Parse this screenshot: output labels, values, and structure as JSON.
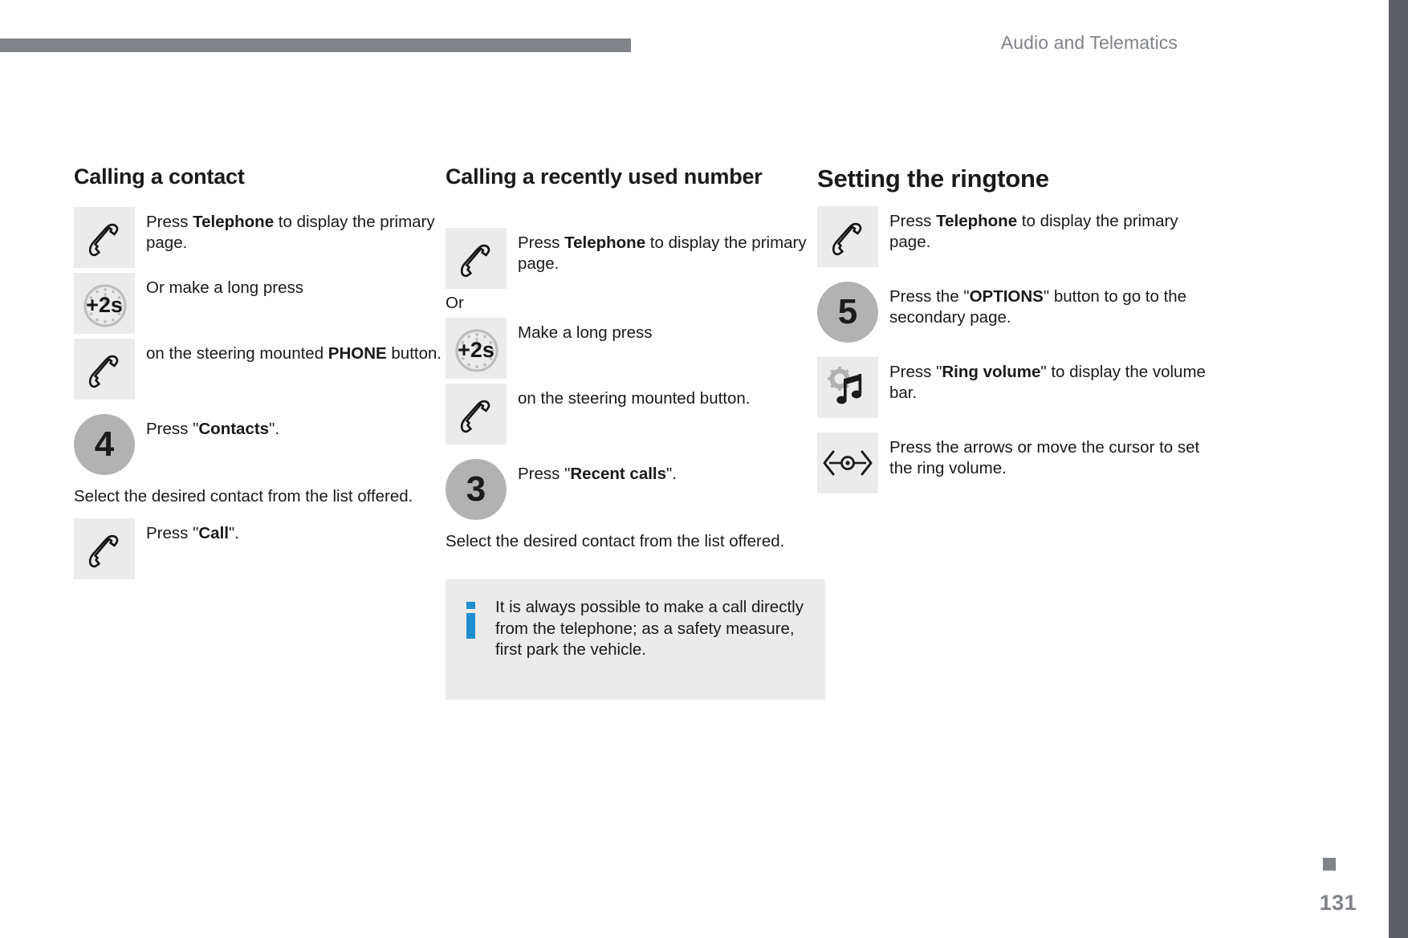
{
  "header": {
    "title": "Audio and Telematics"
  },
  "footer": {
    "page_number": "131"
  },
  "colors": {
    "header_gray": "#808387",
    "edge_bar": "#5c5f64",
    "tile_bg": "#ebebeb",
    "badge_bg": "#b2b2b2",
    "info_blue": "#1f8fce",
    "text": "#1a1a1a"
  },
  "columns": [
    {
      "id": "calling-a-contact",
      "title": "Calling a contact",
      "steps": [
        {
          "icon": "phone-handset-icon",
          "icon_type": "tile",
          "text_html": "Press <b>Telephone</b> to display the primary page.",
          "text_plain": "Press Telephone to display the primary page."
        },
        {
          "icon": "long-press-2s-icon",
          "icon_type": "tile",
          "text_html": "Or make a long press",
          "text_plain": "Or make a long press"
        },
        {
          "icon": "phone-handset-icon",
          "icon_type": "tile",
          "text_html": "on the steering mounted <b>PHONE</b> button.",
          "text_plain": "on the steering mounted PHONE button."
        },
        {
          "icon": "step-number-badge",
          "icon_type": "badge",
          "badge_number": "4",
          "text_html": "Press \"<b>Contacts</b>\".",
          "text_plain": "Press \"Contacts\"."
        }
      ],
      "note": "Select the desired contact from the list offered.",
      "final_step": {
        "icon": "phone-handset-icon",
        "icon_type": "tile",
        "text_html": "Press \"<b>Call</b>\".",
        "text_plain": "Press \"Call\"."
      }
    },
    {
      "id": "calling-a-recently-used-number",
      "title": "Calling a recently used number",
      "steps": [
        {
          "icon": "phone-handset-icon",
          "icon_type": "tile",
          "text_html": "Press <b>Telephone</b> to display the primary page.",
          "text_plain": "Press Telephone to display the primary page."
        }
      ],
      "or_label": "Or",
      "steps_after_or": [
        {
          "icon": "long-press-2s-icon",
          "icon_type": "tile",
          "text_html": "Make a long press",
          "text_plain": "Make a long press"
        },
        {
          "icon": "phone-handset-icon",
          "icon_type": "tile",
          "text_html": "on the steering mounted button.",
          "text_plain": "on the steering mounted button."
        },
        {
          "icon": "step-number-badge",
          "icon_type": "badge",
          "badge_number": "3",
          "text_html": "Press \"<b>Recent calls</b>\".",
          "text_plain": "Press \"Recent calls\"."
        }
      ],
      "note": "Select the desired contact from the list offered.",
      "info_box": {
        "icon": "info-icon",
        "text": "It is always possible to make a call directly from the telephone; as a safety measure, first park the vehicle."
      }
    },
    {
      "id": "setting-the-ringtone",
      "title": "Setting the ringtone",
      "steps": [
        {
          "icon": "phone-handset-icon",
          "icon_type": "tile",
          "text_html": "Press <b>Telephone</b> to display the primary page.",
          "text_plain": "Press Telephone to display the primary page."
        },
        {
          "icon": "step-number-badge",
          "icon_type": "badge",
          "badge_number": "5",
          "text_html": "Press the \"<b>OPTIONS</b>\" button to go to the secondary page.",
          "text_plain": "Press the \"OPTIONS\" button to go to the secondary page."
        },
        {
          "icon": "ring-volume-icon",
          "icon_type": "tile",
          "text_html": "Press \"<b>Ring volume</b>\" to display the volume bar.",
          "text_plain": "Press \"Ring volume\" to display the volume bar."
        },
        {
          "icon": "cursor-arrows-icon",
          "icon_type": "tile",
          "text_html": "Press the arrows or move the cursor to set the ring volume.",
          "text_plain": "Press the arrows or move the cursor to set the ring volume."
        }
      ]
    }
  ]
}
